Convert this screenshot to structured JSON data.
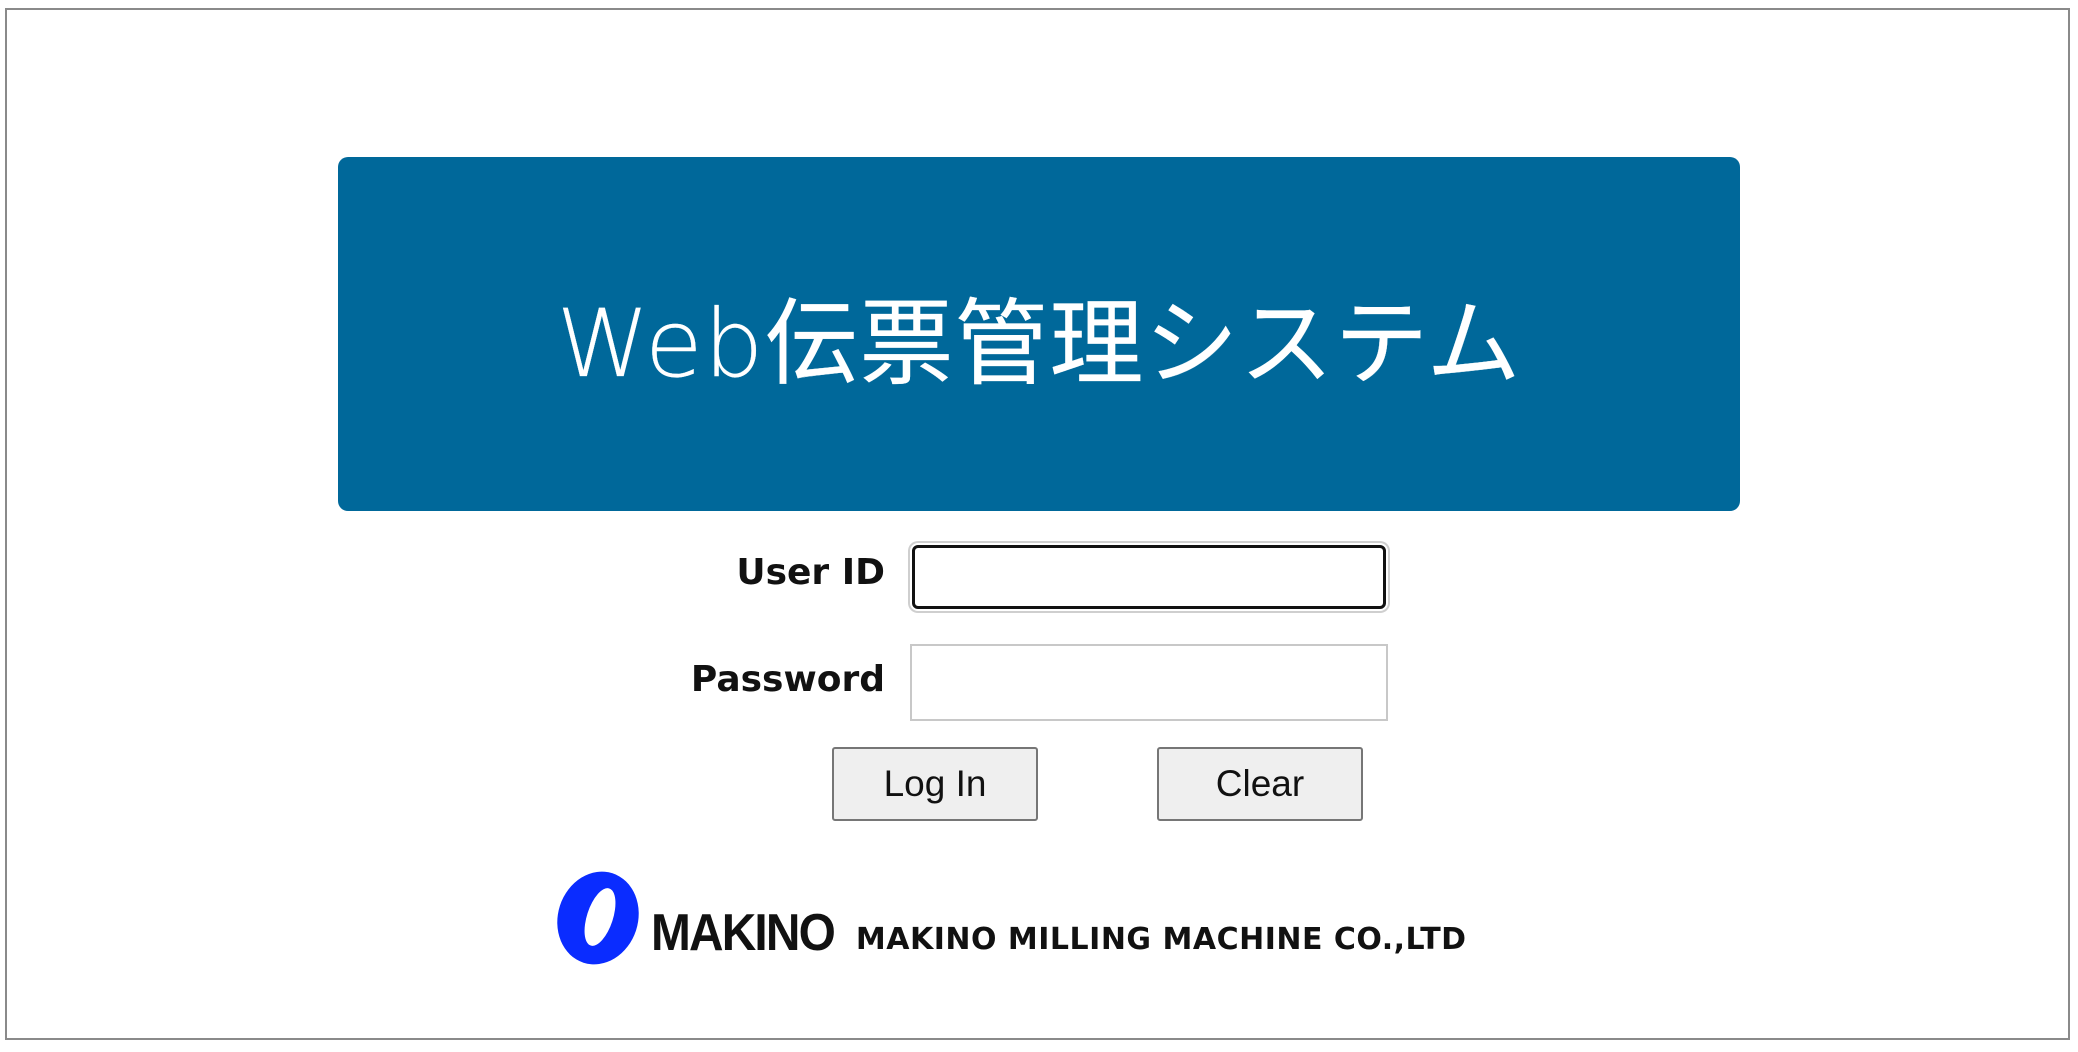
{
  "banner": {
    "title": "Web伝票管理システム",
    "background_color": "#00689a"
  },
  "login_form": {
    "user_id_label": "User ID",
    "user_id_value": "",
    "password_label": "Password",
    "password_value": "",
    "login_button_label": "Log In",
    "clear_button_label": "Clear"
  },
  "footer": {
    "logo_text": "MAKINO",
    "company_name": "MAKINO MILLING MACHINE CO.,LTD",
    "logo_mark_icon": "makino-ring-icon",
    "logo_color": "#0a2cff"
  }
}
